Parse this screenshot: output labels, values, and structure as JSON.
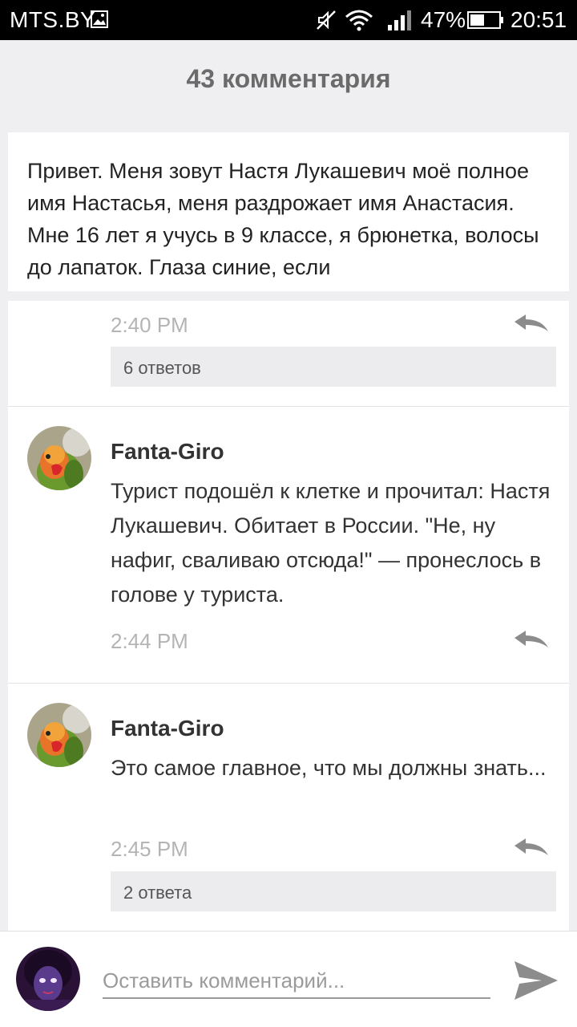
{
  "status_bar": {
    "carrier": "MTS.BY",
    "battery": "47%",
    "time": "20:51",
    "icons": [
      "image-icon",
      "mute-icon",
      "wifi-icon",
      "signal-icon",
      "battery-icon"
    ]
  },
  "page": {
    "title": "43 комментария"
  },
  "post": {
    "text": "Привет. Меня зовут Настя Лукашевич моё полное имя Настасья, меня раздрожает имя Анастасия. Мне 16 лет я учусь в 9 классе, я брюнетка, волосы до лапаток. Глаза синие, если"
  },
  "comments": [
    {
      "time": "2:40 PM",
      "replies": "6 ответов"
    },
    {
      "author": "Fanta-Giro",
      "text": "Турист подошёл к клетке и прочитал: Настя Лукашевич. Обитает в России. \"Не, ну нафиг, сваливаю отсюда!\" — пронеслось в голове у туриста.",
      "time": "2:44 PM"
    },
    {
      "author": "Fanta-Giro",
      "text": "Это самое главное, что мы должны знать...",
      "time": "2:45 PM",
      "replies": "2 ответа"
    }
  ],
  "input": {
    "placeholder": "Оставить комментарий..."
  },
  "colors": {
    "background": "#efeff1",
    "card": "#ffffff",
    "timestamp": "#b4b4b4",
    "icon": "#8c8c8c"
  }
}
